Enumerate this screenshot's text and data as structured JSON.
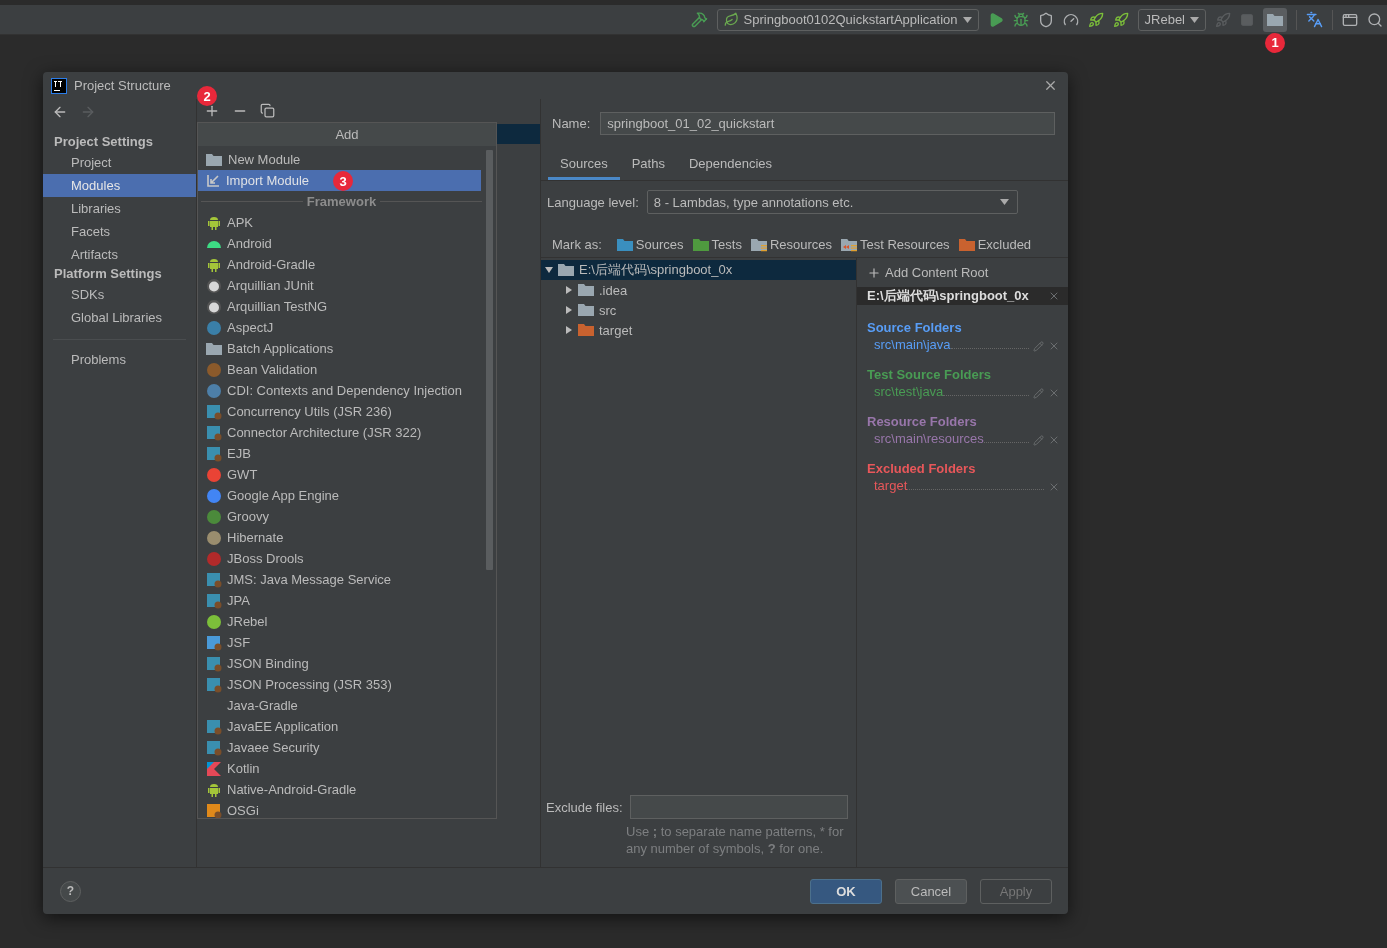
{
  "toolbar": {
    "run_configuration": "Springboot0102QuickstartApplication",
    "jrebel_selector": "JRebel",
    "annotation": "1"
  },
  "dialog": {
    "title": "Project Structure",
    "sidebar": {
      "sections": [
        {
          "title": "Project Settings",
          "items": [
            {
              "label": "Project",
              "selected": false
            },
            {
              "label": "Modules",
              "selected": true
            },
            {
              "label": "Libraries",
              "selected": false
            },
            {
              "label": "Facets",
              "selected": false
            },
            {
              "label": "Artifacts",
              "selected": false
            }
          ]
        },
        {
          "title": "Platform Settings",
          "items": [
            {
              "label": "SDKs",
              "selected": false
            },
            {
              "label": "Global Libraries",
              "selected": false
            }
          ]
        }
      ],
      "problems": "Problems"
    },
    "module_toolbar": {
      "annotation": "2"
    },
    "add_popup": {
      "title": "Add",
      "actions": [
        {
          "label": "New Module",
          "selected": false
        },
        {
          "label": "Import Module",
          "selected": true,
          "annotation": "3"
        }
      ],
      "section": "Framework",
      "frameworks": [
        "APK",
        "Android",
        "Android-Gradle",
        "Arquillian JUnit",
        "Arquillian TestNG",
        "AspectJ",
        "Batch Applications",
        "Bean Validation",
        "CDI: Contexts and Dependency Injection",
        "Concurrency Utils (JSR 236)",
        "Connector Architecture (JSR 322)",
        "EJB",
        "GWT",
        "Google App Engine",
        "Groovy",
        "Hibernate",
        "JBoss Drools",
        "JMS: Java Message Service",
        "JPA",
        "JRebel",
        "JSF",
        "JSON Binding",
        "JSON Processing (JSR 353)",
        "Java-Gradle",
        "JavaEE Application",
        "Javaee Security",
        "Kotlin",
        "Native-Android-Gradle",
        "OSGi"
      ]
    },
    "module": {
      "name_label": "Name:",
      "name": "springboot_01_02_quickstart",
      "tabs": [
        {
          "label": "Sources",
          "selected": true
        },
        {
          "label": "Paths",
          "selected": false
        },
        {
          "label": "Dependencies",
          "selected": false
        }
      ],
      "language_level_label": "Language level:",
      "language_level": "8 - Lambdas, type annotations etc.",
      "mark_as_label": "Mark as:",
      "mark_as": [
        {
          "label": "Sources",
          "color": "#3a8fbf",
          "kind": "plain"
        },
        {
          "label": "Tests",
          "color": "#4f9a3f",
          "kind": "plain"
        },
        {
          "label": "Resources",
          "color": "#9aa7b0",
          "kind": "resources"
        },
        {
          "label": "Test Resources",
          "color": "#9aa7b0",
          "kind": "test_resources"
        },
        {
          "label": "Excluded",
          "color": "#c9622f",
          "kind": "plain"
        }
      ],
      "tree": [
        {
          "label": "E:\\后端代码\\springboot_0x",
          "expanded": true,
          "selected": true,
          "color": "#9aa7b0",
          "children": [
            {
              "label": ".idea",
              "expanded": false,
              "selected": false,
              "color": "#9aa7b0"
            },
            {
              "label": "src",
              "expanded": false,
              "selected": false,
              "color": "#9aa7b0"
            },
            {
              "label": "target",
              "expanded": false,
              "selected": false,
              "color": "#c9622f"
            }
          ]
        }
      ],
      "exclude_label": "Exclude files:",
      "exclude_hint": "Use **;** to separate name patterns, * for any number of symbols, **?** for one.",
      "add_content_root": "Add Content Root",
      "content_root": "E:\\后端代码\\springboot_0x",
      "folder_groups": [
        {
          "title": "Source Folders",
          "color": "#589df6",
          "items": [
            {
              "path": "src\\main\\java",
              "editable": true
            }
          ]
        },
        {
          "title": "Test Source Folders",
          "color": "#499c54",
          "items": [
            {
              "path": "src\\test\\java",
              "editable": true
            }
          ]
        },
        {
          "title": "Resource Folders",
          "color": "#9876aa",
          "items": [
            {
              "path": "src\\main\\resources",
              "editable": true
            }
          ]
        },
        {
          "title": "Excluded Folders",
          "color": "#e8575a",
          "items": [
            {
              "path": "target",
              "editable": false
            }
          ]
        }
      ]
    },
    "help": "?",
    "buttons": [
      {
        "label": "OK",
        "kind": "primary"
      },
      {
        "label": "Cancel",
        "kind": "normal"
      },
      {
        "label": "Apply",
        "kind": "disabled"
      }
    ]
  }
}
